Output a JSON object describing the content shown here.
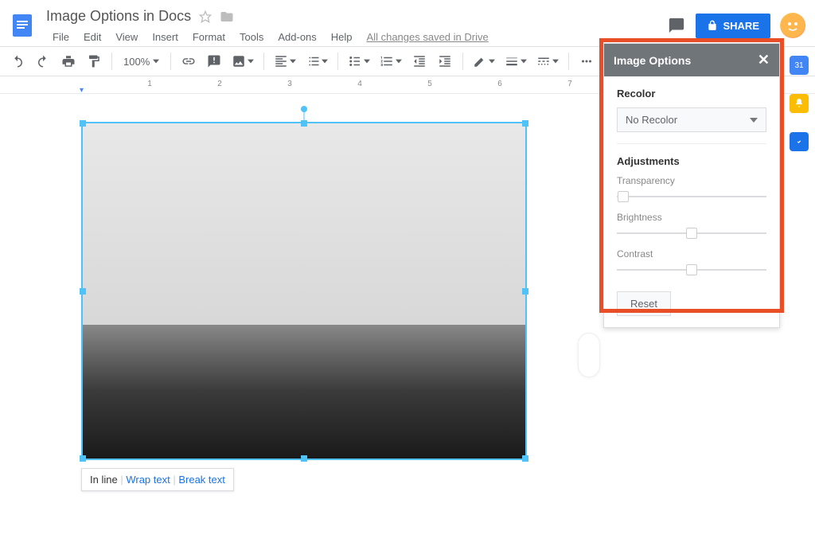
{
  "doc": {
    "title": "Image Options in Docs"
  },
  "menu": {
    "file": "File",
    "edit": "Edit",
    "view": "View",
    "insert": "Insert",
    "format": "Format",
    "tools": "Tools",
    "addons": "Add-ons",
    "help": "Help",
    "save_status": "All changes saved in Drive"
  },
  "header": {
    "share": "SHARE"
  },
  "toolbar": {
    "zoom": "100%"
  },
  "ruler": {
    "m1": "1",
    "m2": "2",
    "m3": "3",
    "m4": "4",
    "m5": "5",
    "m6": "6",
    "m7": "7"
  },
  "wrap": {
    "inline": "In line",
    "wrap": "Wrap text",
    "break": "Break text",
    "sep": " | "
  },
  "panel": {
    "title": "Image Options",
    "recolor_title": "Recolor",
    "recolor_value": "No Recolor",
    "adjustments_title": "Adjustments",
    "transparency": "Transparency",
    "brightness": "Brightness",
    "contrast": "Contrast",
    "reset": "Reset"
  }
}
